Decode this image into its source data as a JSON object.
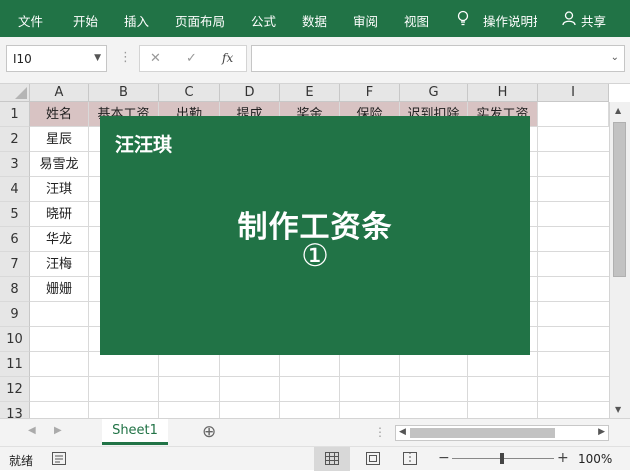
{
  "ribbon": {
    "tabs": [
      "文件",
      "开始",
      "插入",
      "页面布局",
      "公式",
      "数据",
      "审阅",
      "视图"
    ],
    "tell_me": "操作说明搜",
    "share": "共享"
  },
  "formula_bar": {
    "name_box": "I10",
    "cancel_glyph": "✕",
    "enter_glyph": "✓",
    "fx_label": "fx",
    "value": ""
  },
  "sheet": {
    "columns": [
      "A",
      "B",
      "C",
      "D",
      "E",
      "F",
      "G",
      "H",
      "I"
    ],
    "rows": [
      "1",
      "2",
      "3",
      "4",
      "5",
      "6",
      "7",
      "8",
      "9",
      "10",
      "11",
      "12",
      "13"
    ],
    "header_row": [
      "姓名",
      "基本工资",
      "出勤",
      "提成",
      "奖金",
      "保险",
      "迟到扣除",
      "实发工资"
    ],
    "names": [
      "星辰",
      "易雪龙",
      "汪琪",
      "晓研",
      "华龙",
      "汪梅",
      "姗姗"
    ]
  },
  "overlay": {
    "brand": "汪汪琪",
    "title": "制作工资条",
    "number": "①",
    "background": "#217346"
  },
  "tabs_bar": {
    "sheet_name": "Sheet1",
    "add_glyph": "⊕"
  },
  "status": {
    "ready": "就绪",
    "zoom": "100%",
    "minus": "−",
    "plus": "+"
  },
  "colors": {
    "accent": "#217346",
    "header_fill": "#d8c3c3"
  }
}
